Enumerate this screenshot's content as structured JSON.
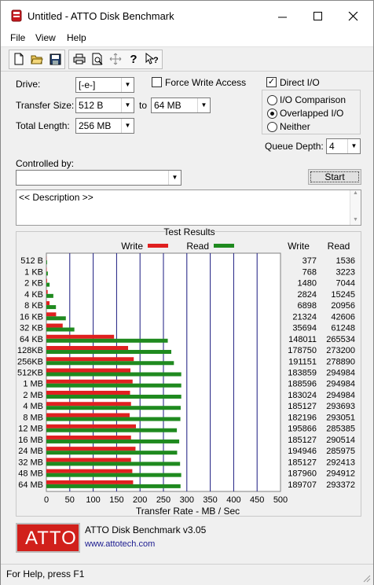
{
  "window": {
    "title": "Untitled - ATTO Disk Benchmark",
    "icons": {
      "app": "disk-app-icon",
      "minimize": "minimize-icon",
      "maximize": "maximize-icon",
      "close": "close-icon"
    }
  },
  "menu": {
    "file": "File",
    "view": "View",
    "help": "Help"
  },
  "toolbar": {
    "icons": [
      "new-document-icon",
      "open-folder-icon",
      "save-icon",
      "print-icon",
      "print-preview-icon",
      "move-icon",
      "help-icon",
      "context-help-icon"
    ]
  },
  "settings": {
    "drive_label": "Drive:",
    "drive_value": "[-e-]",
    "force_write_label": "Force Write Access",
    "force_write_checked": false,
    "direct_io_label": "Direct I/O",
    "direct_io_checked": true,
    "transfer_size_label": "Transfer Size:",
    "transfer_from": "512 B",
    "transfer_to_label": "to",
    "transfer_to": "64 MB",
    "total_length_label": "Total Length:",
    "total_length": "256 MB",
    "io_comparison": "I/O Comparison",
    "overlapped_io": "Overlapped I/O",
    "neither": "Neither",
    "io_mode_selected": "Overlapped I/O",
    "queue_depth_label": "Queue Depth:",
    "queue_depth": "4",
    "controlled_by_label": "Controlled by:",
    "controlled_by_value": "",
    "start_label": "Start",
    "description": "<< Description >>"
  },
  "results": {
    "title": "Test Results",
    "legend_write": "Write",
    "legend_read": "Read",
    "col_write": "Write",
    "col_read": "Read",
    "write_color": "#e02020",
    "read_color": "#1f8a1f"
  },
  "chart_data": {
    "type": "bar",
    "orientation": "horizontal",
    "title": "Test Results",
    "xlabel": "Transfer Rate - MB / Sec",
    "xlim": [
      0,
      500
    ],
    "xticks": [
      0,
      50,
      100,
      150,
      200,
      250,
      300,
      350,
      400,
      450,
      500
    ],
    "categories": [
      "512 B",
      "1 KB",
      "2 KB",
      "4 KB",
      "8 KB",
      "16 KB",
      "32 KB",
      "64 KB",
      "128KB",
      "256KB",
      "512KB",
      "1 MB",
      "2 MB",
      "4 MB",
      "8 MB",
      "12 MB",
      "16 MB",
      "24 MB",
      "32 MB",
      "48 MB",
      "64 MB"
    ],
    "series": [
      {
        "name": "Write",
        "values": [
          377,
          768,
          1480,
          2824,
          6898,
          21324,
          35694,
          148011,
          178750,
          191151,
          183859,
          188596,
          183024,
          185127,
          182196,
          195866,
          185127,
          194946,
          185127,
          187960,
          189707
        ]
      },
      {
        "name": "Read",
        "values": [
          1536,
          3223,
          7044,
          15245,
          20956,
          42606,
          61248,
          265534,
          273200,
          278890,
          294984,
          294984,
          294984,
          293693,
          293051,
          285385,
          290514,
          285975,
          292413,
          294912,
          293372
        ]
      }
    ],
    "values_unit_display": "KB/s",
    "grid": true,
    "legend": "top"
  },
  "footer": {
    "logo_text": "ATTO",
    "product": "ATTO Disk Benchmark v3.05",
    "url": "www.attotech.com"
  },
  "status": {
    "text": "For Help, press F1"
  }
}
